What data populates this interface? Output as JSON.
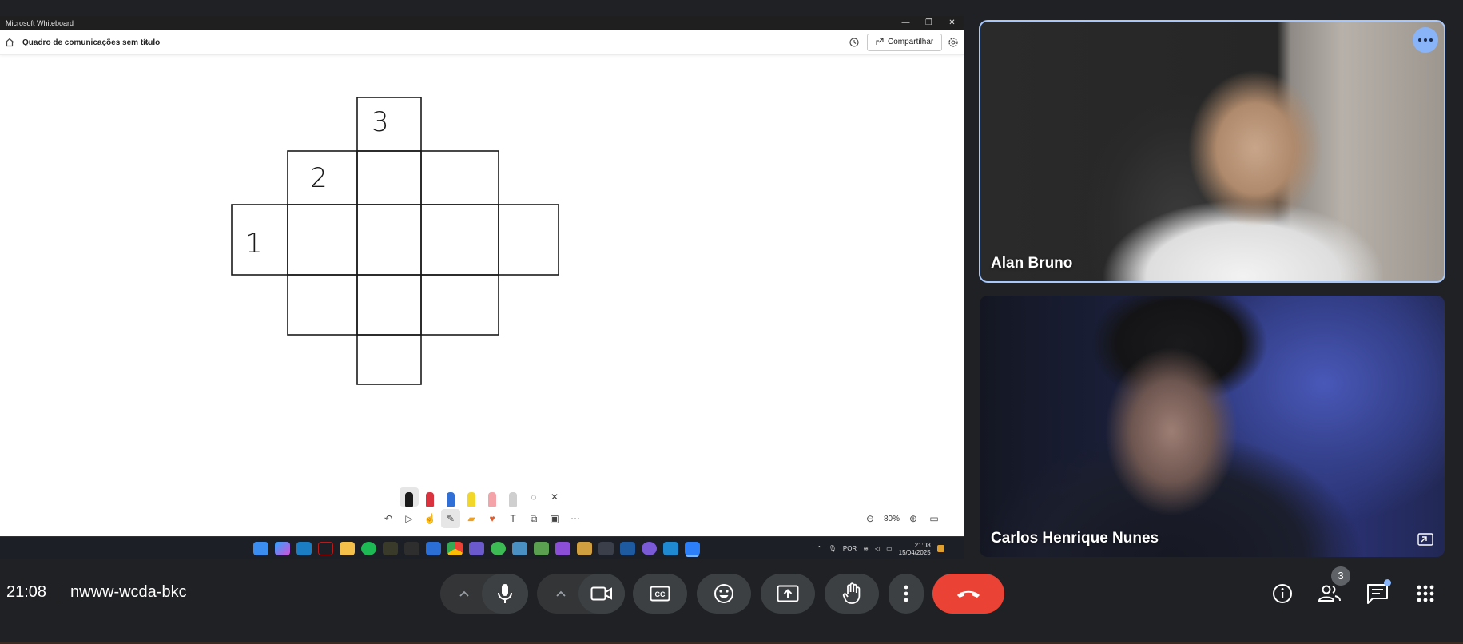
{
  "whiteboard": {
    "window_title": "Microsoft Whiteboard",
    "window_controls": {
      "minimize": "—",
      "restore": "❐",
      "close": "✕"
    },
    "board_title": "Quadro de comunicações sem título",
    "share_label": "Compartilhar",
    "labels": {
      "one": "1",
      "two": "2",
      "three": "3"
    },
    "zoom_level": "80%",
    "pen_colors": [
      "#1a1a1a",
      "#d8333f",
      "#2f6fd6",
      "#f2d729",
      "#f4a4a8",
      "#cfcfcf"
    ]
  },
  "taskbar": {
    "language": "POR",
    "time": "21:08",
    "date": "15/04/2025"
  },
  "participants": [
    {
      "name": "Alan Bruno"
    },
    {
      "name": "Carlos Henrique Nunes"
    }
  ],
  "meet": {
    "time": "21:08",
    "code": "nwww-wcda-bkc",
    "participant_count": "3"
  },
  "colors": {
    "meet_background": "#202124",
    "end_call": "#ea4335",
    "active_speaker_outline": "#a8c7fa",
    "badge_dot": "#8ab4f8"
  }
}
